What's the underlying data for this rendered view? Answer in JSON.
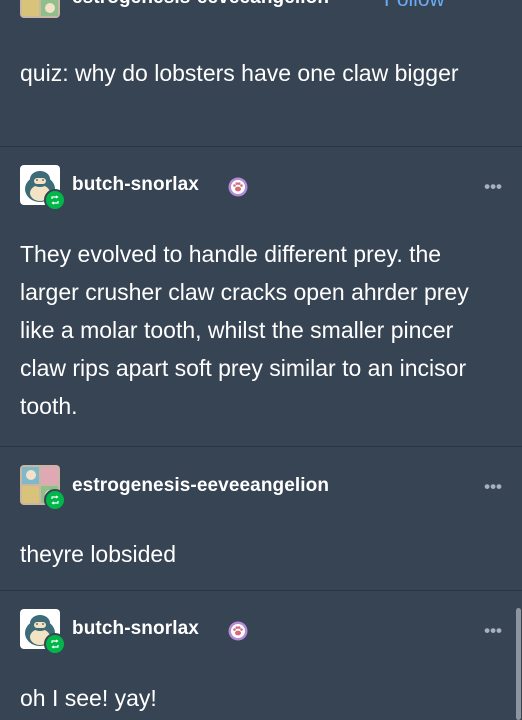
{
  "thread": [
    {
      "username": "estrogenesis-eeveeangelion",
      "follow_label": "Follow",
      "avatar_icon": "collage-avatar-icon",
      "text": "quiz: why do lobsters have one claw bigger"
    },
    {
      "username": "butch-snorlax",
      "avatar_icon": "snorlax-avatar-icon",
      "badge_icon": "paw-badge-icon",
      "text": "They evolved to handle different prey. the larger crusher claw cracks open ahrder prey like a molar tooth, whilst the smaller pincer claw rips apart soft prey similar to an incisor tooth."
    },
    {
      "username": "estrogenesis-eeveeangelion",
      "avatar_icon": "collage-avatar-icon",
      "text": "theyre lobsided"
    },
    {
      "username": "butch-snorlax",
      "avatar_icon": "snorlax-avatar-icon",
      "badge_icon": "paw-badge-icon",
      "text": "oh I see! yay!"
    }
  ],
  "more_label": "•••",
  "colors": {
    "background": "#374454",
    "text": "#ffffff",
    "follow_link": "#6aaaf1",
    "reblog_badge": "#00b84a",
    "paw_badge": "#b58ad6"
  }
}
